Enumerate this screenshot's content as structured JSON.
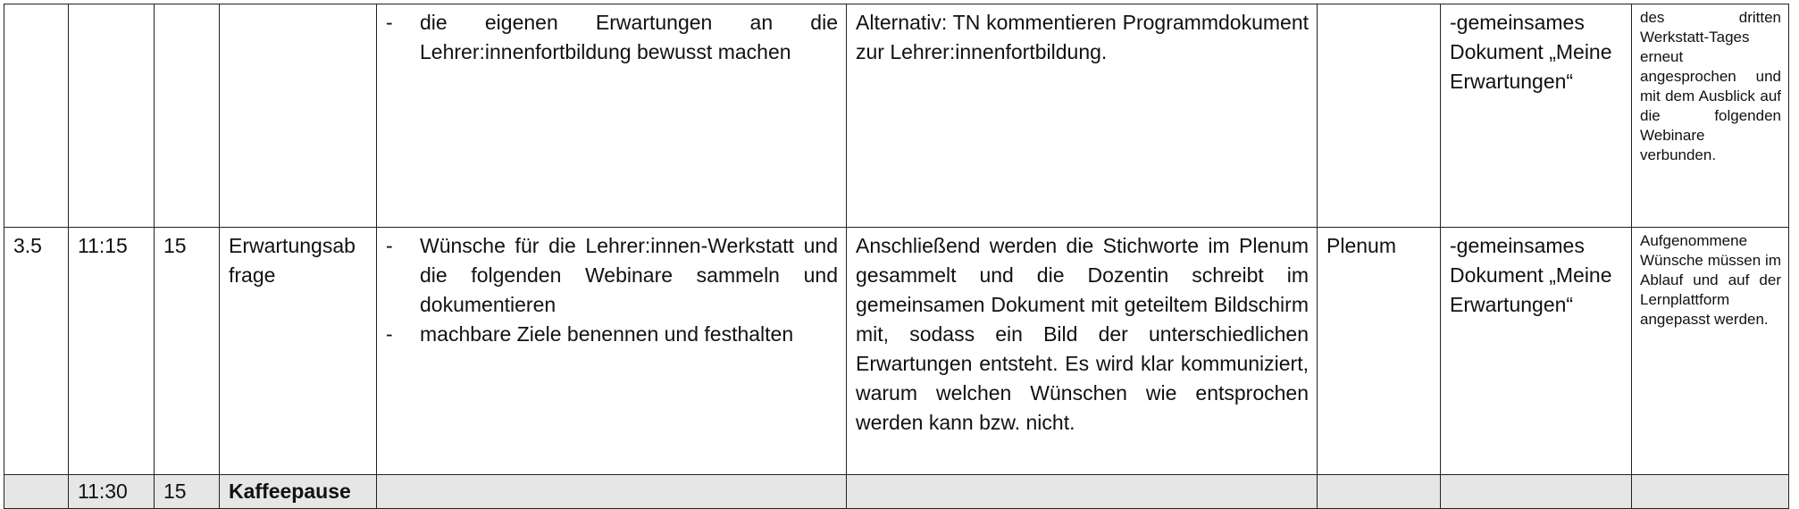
{
  "rows": [
    {
      "nr": "",
      "time": "",
      "duration": "",
      "title": "",
      "goals": [
        "die eigenen Erwartungen an die Lehrer:innenfortbildung bewusst machen"
      ],
      "description": "Alternativ: TN kommentieren Programmdokument zur Lehrer:innenfortbildung.",
      "social_form": "",
      "materials": "-gemeinsames Dokument „Meine Erwartungen“",
      "notes": "des dritten Werkstatt-Tages erneut angesprochen und mit dem Ausblick auf die folgenden Webinare verbunden."
    },
    {
      "nr": "3.5",
      "time": "11:15",
      "duration": "15",
      "title": "Erwartungsab frage",
      "goals": [
        "Wünsche für die Lehrer:innen-Werkstatt und die folgenden Webinare sammeln und dokumentieren",
        "machbare Ziele benennen und festhalten"
      ],
      "description": "Anschließend werden die Stichworte im Plenum gesammelt und die Dozentin schreibt im gemeinsamen Dokument mit geteiltem Bildschirm mit, sodass ein Bild der unterschiedlichen Erwartungen entsteht. Es wird klar kommuniziert, warum welchen Wünschen wie entsprochen werden kann bzw. nicht.",
      "social_form": "Plenum",
      "materials": "-gemeinsames Dokument „Meine Erwartungen“",
      "notes": "Aufgenommene Wünsche müssen im Ablauf und auf der Lernplattform angepasst werden."
    },
    {
      "nr": "",
      "time": "11:30",
      "duration": "15",
      "title": "Kaffeepause",
      "description": "",
      "social_form": "",
      "materials": "",
      "notes": ""
    }
  ],
  "dash_glyph": "-"
}
